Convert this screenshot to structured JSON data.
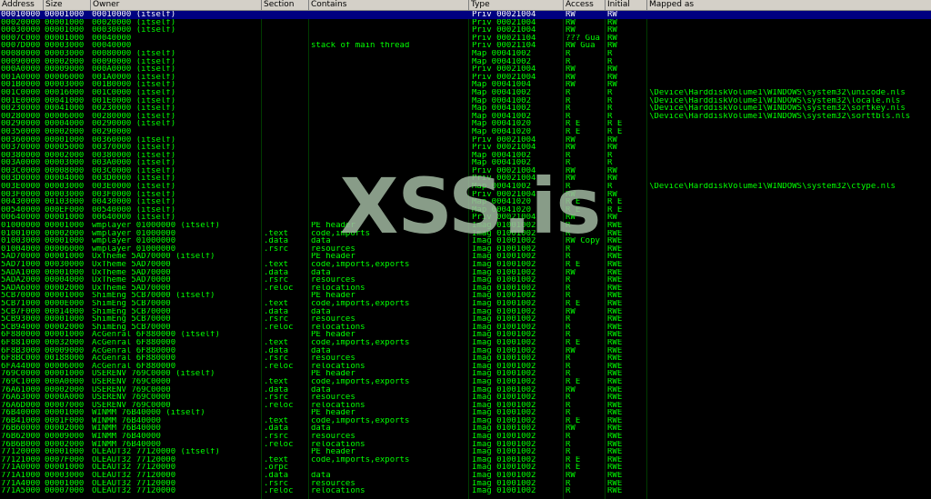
{
  "columns": [
    "Address",
    "Size",
    "Owner",
    "Section",
    "Contains",
    "Type",
    "Access",
    "Initial",
    "Mapped as"
  ],
  "selected_row": 0,
  "watermark": "XSS.is",
  "rows": [
    [
      "00010000",
      "00001000",
      "00010000 (itself)",
      "",
      "",
      "Priv 00021004",
      "RW",
      "RW",
      ""
    ],
    [
      "00020000",
      "00001000",
      "00020000 (itself)",
      "",
      "",
      "Priv 00021004",
      "RW",
      "RW",
      ""
    ],
    [
      "00030000",
      "00001000",
      "00030000 (itself)",
      "",
      "",
      "Priv 00021004",
      "RW",
      "RW",
      ""
    ],
    [
      "0007C000",
      "00001000",
      "00040000",
      "",
      "",
      "Priv 00021104",
      "??? Gua",
      "RW",
      ""
    ],
    [
      "0007D000",
      "00003000",
      "00040000",
      "",
      "stack of main thread",
      "Priv 00021104",
      "RW Gua",
      "RW",
      ""
    ],
    [
      "00080000",
      "00003000",
      "00080000 (itself)",
      "",
      "",
      "Map 00041002",
      "R",
      "R",
      ""
    ],
    [
      "00090000",
      "00002000",
      "00090000 (itself)",
      "",
      "",
      "Map 00041002",
      "R",
      "R",
      ""
    ],
    [
      "000A0000",
      "00009000",
      "000A0000 (itself)",
      "",
      "",
      "Priv 00021004",
      "RW",
      "RW",
      ""
    ],
    [
      "001A0000",
      "00006000",
      "001A0000 (itself)",
      "",
      "",
      "Priv 00021004",
      "RW",
      "RW",
      ""
    ],
    [
      "001B0000",
      "00003000",
      "001B0000 (itself)",
      "",
      "",
      "Map 00041004",
      "RW",
      "RW",
      ""
    ],
    [
      "001C0000",
      "00016000",
      "001C0000 (itself)",
      "",
      "",
      "Map 00041002",
      "R",
      "R",
      "\\Device\\HarddiskVolume1\\WINDOWS\\system32\\unicode.nls"
    ],
    [
      "001E0000",
      "00041000",
      "001E0000 (itself)",
      "",
      "",
      "Map 00041002",
      "R",
      "R",
      "\\Device\\HarddiskVolume1\\WINDOWS\\system32\\locale.nls"
    ],
    [
      "00230000",
      "00041000",
      "00230000 (itself)",
      "",
      "",
      "Map 00041002",
      "R",
      "R",
      "\\Device\\HarddiskVolume1\\WINDOWS\\system32\\sortkey.nls"
    ],
    [
      "00280000",
      "00006000",
      "00280000 (itself)",
      "",
      "",
      "Map 00041002",
      "R",
      "R",
      "\\Device\\HarddiskVolume1\\WINDOWS\\system32\\sorttbls.nls"
    ],
    [
      "00290000",
      "00004000",
      "00290000 (itself)",
      "",
      "",
      "Map 00041020",
      "R E",
      "R E",
      ""
    ],
    [
      "00350000",
      "00002000",
      "00290000",
      "",
      "",
      "Map 00041020",
      "R E",
      "R E",
      ""
    ],
    [
      "00360000",
      "00001000",
      "00360000 (itself)",
      "",
      "",
      "Priv 00021004",
      "RW",
      "RW",
      ""
    ],
    [
      "00370000",
      "00005000",
      "00370000 (itself)",
      "",
      "",
      "Priv 00021004",
      "RW",
      "RW",
      ""
    ],
    [
      "00380000",
      "00002000",
      "00380000 (itself)",
      "",
      "",
      "Map 00041002",
      "R",
      "R",
      ""
    ],
    [
      "003A0000",
      "00003000",
      "003A0000 (itself)",
      "",
      "",
      "Map 00041002",
      "R",
      "R",
      ""
    ],
    [
      "003C0000",
      "00008000",
      "003C0000 (itself)",
      "",
      "",
      "Priv 00021004",
      "RW",
      "RW",
      ""
    ],
    [
      "003D0000",
      "00004000",
      "003D0000 (itself)",
      "",
      "",
      "Priv 00021004",
      "RW",
      "RW",
      ""
    ],
    [
      "003E0000",
      "00003000",
      "003E0000 (itself)",
      "",
      "",
      "Map 00041002",
      "R",
      "R",
      "\\Device\\HarddiskVolume1\\WINDOWS\\system32\\ctype.nls"
    ],
    [
      "003F0000",
      "00003000",
      "003F0000 (itself)",
      "",
      "",
      "Priv 00021004",
      "RW",
      "RW",
      ""
    ],
    [
      "00430000",
      "00103000",
      "00430000 (itself)",
      "",
      "",
      "Map 00041020",
      "R E",
      "R E",
      ""
    ],
    [
      "00540000",
      "000EF000",
      "00540000 (itself)",
      "",
      "",
      "Map 00041020",
      "R E",
      "R E",
      ""
    ],
    [
      "00640000",
      "00001000",
      "00640000 (itself)",
      "",
      "",
      "Priv 00021004",
      "RW",
      "RW",
      ""
    ],
    [
      "01000000",
      "00001000",
      "wmplayer 01000000 (itself)",
      "",
      "PE header",
      "Imag 01001002",
      "R",
      "RWE",
      ""
    ],
    [
      "01001000",
      "00002000",
      "wmplayer 01000000",
      ".text",
      "code,imports",
      "Imag 01001002",
      "R",
      "RWE",
      ""
    ],
    [
      "01003000",
      "00001000",
      "wmplayer 01000000",
      ".data",
      "data",
      "Imag 01001002",
      "RW Copy",
      "RWE",
      ""
    ],
    [
      "01004000",
      "00006000",
      "wmplayer 01000000",
      ".rsrc",
      "resources",
      "Imag 01001002",
      "R",
      "RWE",
      ""
    ],
    [
      "5AD70000",
      "00001000",
      "UxTheme 5AD70000 (itself)",
      "",
      "PE header",
      "Imag 01001002",
      "R",
      "RWE",
      ""
    ],
    [
      "5AD71000",
      "00030000",
      "UxTheme 5AD70000",
      ".text",
      "code,imports,exports",
      "Imag 01001002",
      "R E",
      "RWE",
      ""
    ],
    [
      "5ADA1000",
      "00001000",
      "UxTheme 5AD70000",
      ".data",
      "data",
      "Imag 01001002",
      "RW",
      "RWE",
      ""
    ],
    [
      "5ADA2000",
      "00004000",
      "UxTheme 5AD70000",
      ".rsrc",
      "resources",
      "Imag 01001002",
      "R",
      "RWE",
      ""
    ],
    [
      "5ADA6000",
      "00002000",
      "UxTheme 5AD70000",
      ".reloc",
      "relocations",
      "Imag 01001002",
      "R",
      "RWE",
      ""
    ],
    [
      "5CB70000",
      "00001000",
      "ShimEng 5CB70000 (itself)",
      "",
      "PE header",
      "Imag 01001002",
      "R",
      "RWE",
      ""
    ],
    [
      "5CB71000",
      "0000E000",
      "ShimEng 5CB70000",
      ".text",
      "code,imports,exports",
      "Imag 01001002",
      "R E",
      "RWE",
      ""
    ],
    [
      "5CB7F000",
      "00014000",
      "ShimEng 5CB70000",
      ".data",
      "data",
      "Imag 01001002",
      "RW",
      "RWE",
      ""
    ],
    [
      "5CB93000",
      "00001000",
      "ShimEng 5CB70000",
      ".rsrc",
      "resources",
      "Imag 01001002",
      "R",
      "RWE",
      ""
    ],
    [
      "5CB94000",
      "00002000",
      "ShimEng 5CB70000",
      ".reloc",
      "relocations",
      "Imag 01001002",
      "R",
      "RWE",
      ""
    ],
    [
      "6F880000",
      "00001000",
      "AcGenral 6F880000 (itself)",
      "",
      "PE header",
      "Imag 01001002",
      "R",
      "RWE",
      ""
    ],
    [
      "6F881000",
      "00032000",
      "AcGenral 6F880000",
      ".text",
      "code,imports,exports",
      "Imag 01001002",
      "R E",
      "RWE",
      ""
    ],
    [
      "6F8B3000",
      "00009000",
      "AcGenral 6F880000",
      ".data",
      "data",
      "Imag 01001002",
      "RW",
      "RWE",
      ""
    ],
    [
      "6F8BC000",
      "00188000",
      "AcGenral 6F880000",
      ".rsrc",
      "resources",
      "Imag 01001002",
      "R",
      "RWE",
      ""
    ],
    [
      "6FA44000",
      "00006000",
      "AcGenral 6F880000",
      ".reloc",
      "relocations",
      "Imag 01001002",
      "R",
      "RWE",
      ""
    ],
    [
      "769C0000",
      "00001000",
      "USERENV 769C0000 (itself)",
      "",
      "PE header",
      "Imag 01001002",
      "R",
      "RWE",
      ""
    ],
    [
      "769C1000",
      "000A0000",
      "USERENV 769C0000",
      ".text",
      "code,imports,exports",
      "Imag 01001002",
      "R E",
      "RWE",
      ""
    ],
    [
      "76A61000",
      "00002000",
      "USERENV 769C0000",
      ".data",
      "data",
      "Imag 01001002",
      "RW",
      "RWE",
      ""
    ],
    [
      "76A63000",
      "0000A000",
      "USERENV 769C0000",
      ".rsrc",
      "resources",
      "Imag 01001002",
      "R",
      "RWE",
      ""
    ],
    [
      "76A6D000",
      "00007000",
      "USERENV 769C0000",
      ".reloc",
      "relocations",
      "Imag 01001002",
      "R",
      "RWE",
      ""
    ],
    [
      "76B40000",
      "00001000",
      "WINMM 76B40000 (itself)",
      "",
      "PE header",
      "Imag 01001002",
      "R",
      "RWE",
      ""
    ],
    [
      "76B41000",
      "0001F000",
      "WINMM 76B40000",
      ".text",
      "code,imports,exports",
      "Imag 01001002",
      "R E",
      "RWE",
      ""
    ],
    [
      "76B60000",
      "00002000",
      "WINMM 76B40000",
      ".data",
      "data",
      "Imag 01001002",
      "RW",
      "RWE",
      ""
    ],
    [
      "76B62000",
      "00009000",
      "WINMM 76B40000",
      ".rsrc",
      "resources",
      "Imag 01001002",
      "R",
      "RWE",
      ""
    ],
    [
      "76B6B000",
      "00002000",
      "WINMM 76B40000",
      ".reloc",
      "relocations",
      "Imag 01001002",
      "R",
      "RWE",
      ""
    ],
    [
      "77120000",
      "00001000",
      "OLEAUT32 77120000 (itself)",
      "",
      "PE header",
      "Imag 01001002",
      "R",
      "RWE",
      ""
    ],
    [
      "77121000",
      "0007F000",
      "OLEAUT32 77120000",
      ".text",
      "code,imports,exports",
      "Imag 01001002",
      "R E",
      "RWE",
      ""
    ],
    [
      "771A0000",
      "00001000",
      "OLEAUT32 77120000",
      ".orpc",
      "",
      "Imag 01001002",
      "R E",
      "RWE",
      ""
    ],
    [
      "771A1000",
      "00003000",
      "OLEAUT32 77120000",
      ".data",
      "data",
      "Imag 01001002",
      "RW",
      "RWE",
      ""
    ],
    [
      "771A4000",
      "00001000",
      "OLEAUT32 77120000",
      ".rsrc",
      "resources",
      "Imag 01001002",
      "R",
      "RWE",
      ""
    ],
    [
      "771A5000",
      "00007000",
      "OLEAUT32 77120000",
      ".reloc",
      "relocations",
      "Imag 01001002",
      "R",
      "RWE",
      ""
    ]
  ]
}
